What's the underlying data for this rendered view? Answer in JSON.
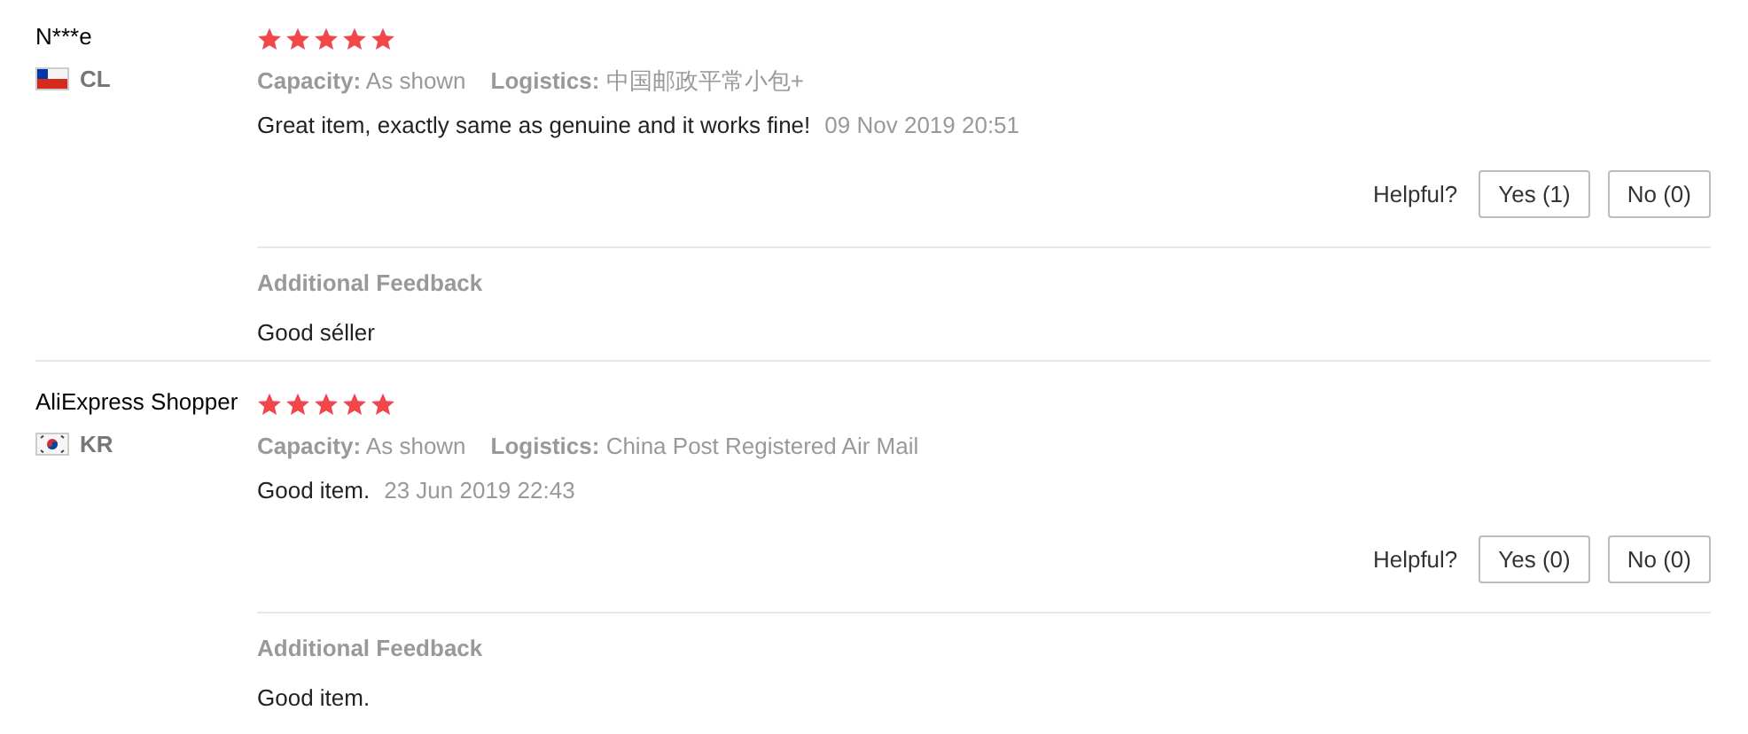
{
  "reviews": [
    {
      "name": "N***e",
      "country": {
        "kind": "chile",
        "code": "CL"
      },
      "stars": 5,
      "capacity_label": "Capacity:",
      "capacity": "As shown",
      "logistics_label": "Logistics:",
      "logistics": "中国邮政平常小包+",
      "text": "Great item, exactly same as genuine and it works fine!",
      "date": "09 Nov 2019 20:51",
      "helpful_label": "Helpful?",
      "yes": "Yes (1)",
      "no": "No (0)",
      "additional_title": "Additional Feedback",
      "additional_text": "Good séller"
    },
    {
      "name": "AliExpress Shopper",
      "country": {
        "kind": "korea",
        "code": "KR"
      },
      "stars": 5,
      "capacity_label": "Capacity:",
      "capacity": "As shown",
      "logistics_label": "Logistics:",
      "logistics": "China Post Registered Air Mail",
      "text": "Good item.",
      "date": "23 Jun 2019 22:43",
      "helpful_label": "Helpful?",
      "yes": "Yes (0)",
      "no": "No (0)",
      "additional_title": "Additional Feedback",
      "additional_text": "Good item."
    }
  ]
}
